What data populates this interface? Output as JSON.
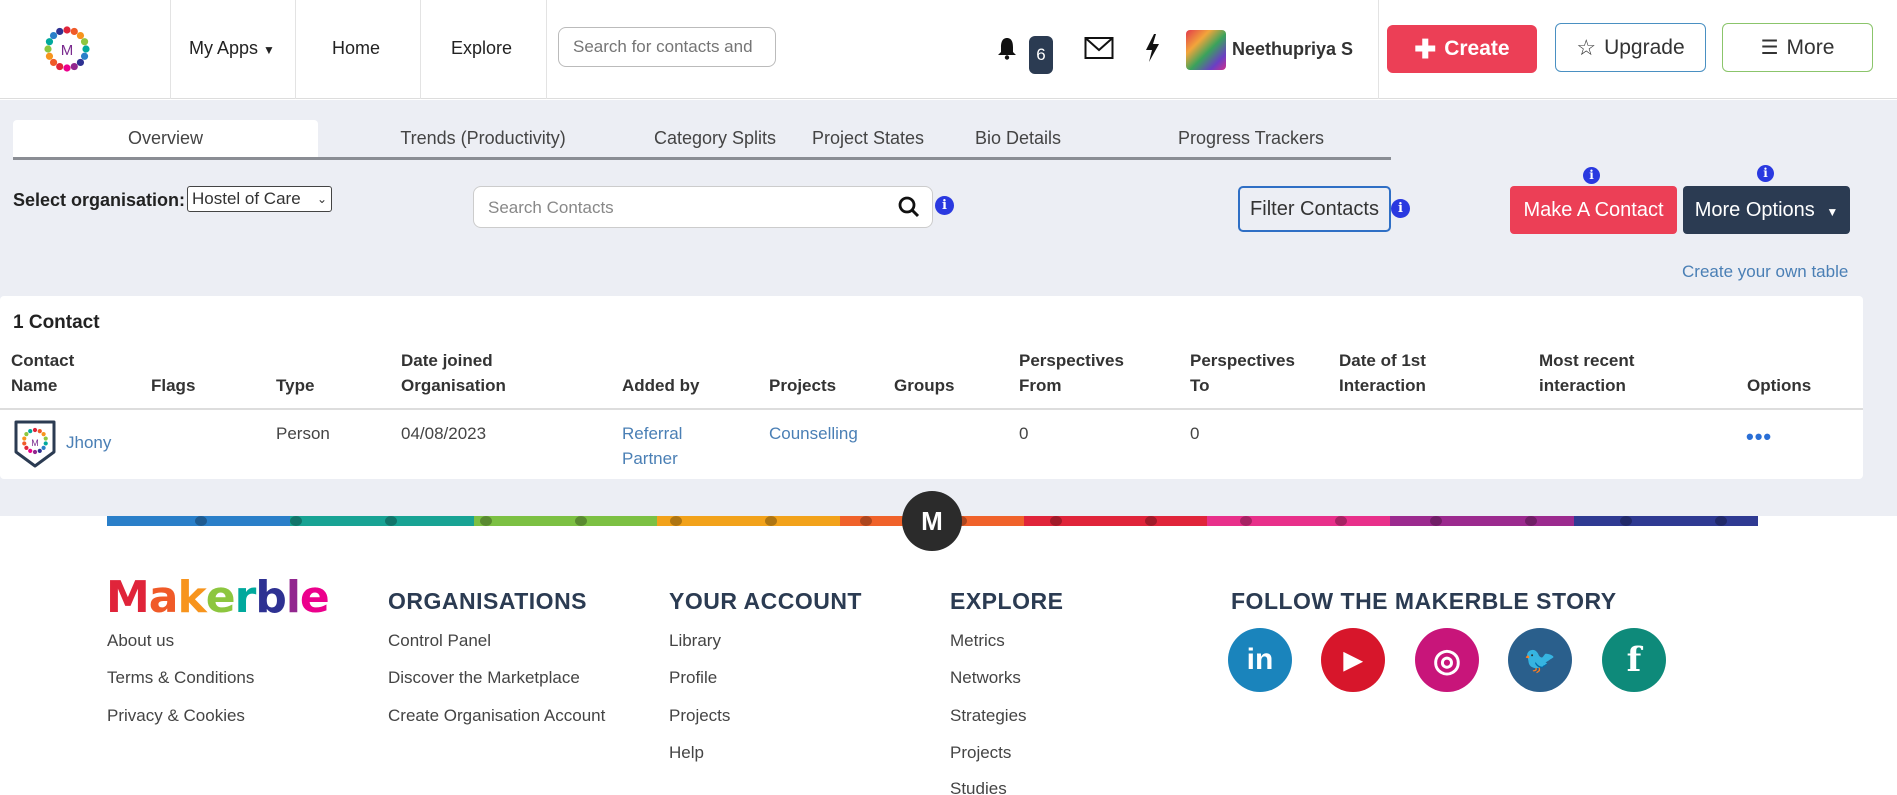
{
  "nav": {
    "my_apps": "My Apps",
    "home": "Home",
    "explore": "Explore",
    "search_placeholder": "Search for contacts and",
    "notifications_count": "6",
    "user_name": "Neethupriya S",
    "create": "Create",
    "upgrade": "Upgrade",
    "more": "More"
  },
  "tabs": [
    {
      "label": "Overview",
      "active": true
    },
    {
      "label": "Trends (Productivity)"
    },
    {
      "label": "Category Splits"
    },
    {
      "label": "Project States"
    },
    {
      "label": "Bio Details"
    },
    {
      "label": "Progress Trackers"
    }
  ],
  "toolbar": {
    "org_label": "Select organisation:",
    "org_value": "Hostel of Care",
    "search_placeholder": "Search Contacts",
    "filter": "Filter Contacts",
    "make_contact": "Make A Contact",
    "more_options": "More Options",
    "create_table": "Create your own table",
    "info_glyph": "i"
  },
  "table": {
    "title": "1 Contact",
    "headers": [
      [
        "Contact",
        "Name"
      ],
      [
        "Flags"
      ],
      [
        "Type"
      ],
      [
        "Date joined",
        "Organisation"
      ],
      [
        "Added by"
      ],
      [
        "Projects"
      ],
      [
        "Groups"
      ],
      [
        "Perspectives",
        "From"
      ],
      [
        "Perspectives",
        "To"
      ],
      [
        "Date of 1st",
        "Interaction"
      ],
      [
        "Most recent",
        "interaction"
      ],
      [
        "Options"
      ]
    ],
    "rows": [
      {
        "name": "Jhony",
        "type": "Person",
        "date_joined": "04/08/2023",
        "added_by": [
          "Referral",
          "Partner"
        ],
        "projects": "Counselling",
        "perspectives_from": "0",
        "perspectives_to": "0",
        "options": "•••"
      }
    ]
  },
  "footer": {
    "m_badge": "M",
    "brand": "Makerble",
    "brand_colors": [
      "#e0243a",
      "#f05a28",
      "#f7941d",
      "#8dc63f",
      "#00a99d",
      "#2e3192",
      "#92278f",
      "#ec008c"
    ],
    "columns": [
      {
        "heading": "",
        "links": [
          "About us",
          "Terms & Conditions",
          "Privacy & Cookies"
        ]
      },
      {
        "heading": "ORGANISATIONS",
        "links": [
          "Control Panel",
          "Discover the Marketplace",
          "Create Organisation Account"
        ]
      },
      {
        "heading": "YOUR ACCOUNT",
        "links": [
          "Library",
          "Profile",
          "Projects",
          "Help"
        ]
      },
      {
        "heading": "EXPLORE",
        "links": [
          "Metrics",
          "Networks",
          "Strategies",
          "Projects",
          "Studies"
        ]
      },
      {
        "heading": "FOLLOW THE MAKERBLE STORY",
        "links": []
      }
    ],
    "social": [
      {
        "name": "linkedin-icon",
        "glyph": "in",
        "color": "#1a84bc"
      },
      {
        "name": "youtube-icon",
        "glyph": "▶",
        "color": "#d7162b"
      },
      {
        "name": "instagram-icon",
        "glyph": "◎",
        "color": "#c8157a"
      },
      {
        "name": "twitter-icon",
        "glyph": "🐦",
        "color": "#2a5f8c"
      },
      {
        "name": "facebook-icon",
        "glyph": "f",
        "color": "#0e8a7a"
      }
    ],
    "stripe_colors": [
      "#2a7fc9",
      "#18a394",
      "#7cc043",
      "#f2a21a",
      "#f0622a",
      "#e0243a",
      "#e8308a",
      "#9b2a8e",
      "#2f3a92"
    ]
  }
}
